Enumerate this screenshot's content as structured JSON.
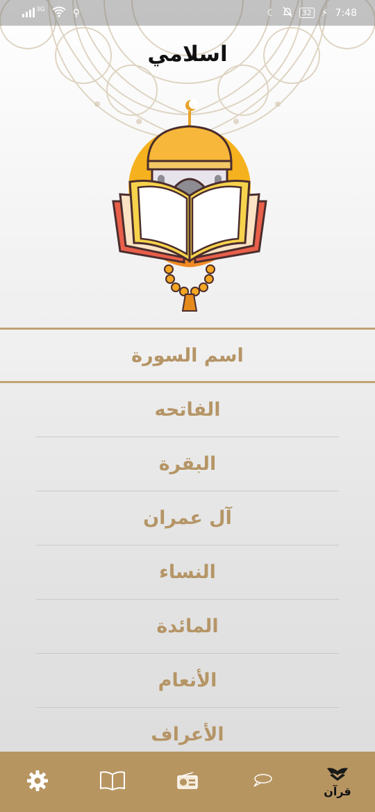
{
  "status_bar": {
    "signal_label": "3G",
    "battery": "32",
    "time": "7:48"
  },
  "app": {
    "title": "اسلامي"
  },
  "list_header": "اسم السورة",
  "surahs": [
    "الفاتحه",
    "البقرة",
    "آل عمران",
    "النساء",
    "المائدة",
    "الأنعام",
    "الأعراف"
  ],
  "bottom_nav": {
    "items": [
      {
        "icon": "gear-icon"
      },
      {
        "icon": "book-icon"
      },
      {
        "icon": "radio-icon"
      },
      {
        "icon": "chat-icon"
      },
      {
        "icon": "quran-icon",
        "label": "قرآن",
        "active": true
      }
    ]
  },
  "colors": {
    "accent": "#b79561",
    "text_gold": "#b59566",
    "divider": "#c9c9c9"
  }
}
